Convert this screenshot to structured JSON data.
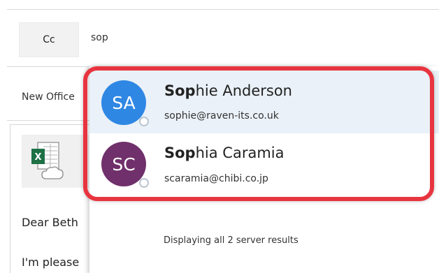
{
  "compose": {
    "cc_label": "Cc",
    "cc_value": "sop",
    "subject_partial": "New Office",
    "body_lines": [
      "Dear Beth",
      "I'm please"
    ]
  },
  "suggestions": [
    {
      "initials": "SA",
      "name_match": "Sop",
      "name_rest": "hie Anderson",
      "email": "sophie@raven-its.co.uk",
      "avatar_color": "#2f87e4"
    },
    {
      "initials": "SC",
      "name_match": "Sop",
      "name_rest": "hia Caramia",
      "email": "scaramia@chibi.co.jp",
      "avatar_color": "#70306b"
    }
  ],
  "results_text": "Displaying all 2 server results",
  "colors": {
    "highlight": "#e8343f",
    "hover_row": "#eaf1f8",
    "excel_green": "#1e7145"
  }
}
